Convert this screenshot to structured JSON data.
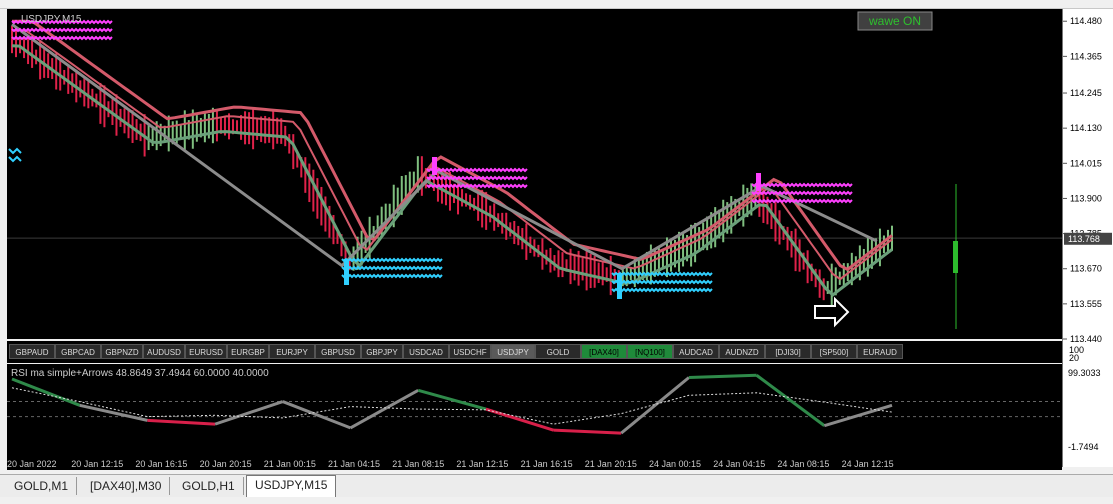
{
  "chart_title": "USDJPY,M15",
  "wawe_button": "wawe ON",
  "price_axis": [
    "114.480",
    "114.365",
    "114.245",
    "114.130",
    "114.015",
    "113.900",
    "113.785",
    "113.670",
    "113.555",
    "113.440"
  ],
  "current_price": "113.768",
  "symbol_buttons": [
    "GBPAUD",
    "GBPCAD",
    "GBPNZD",
    "AUDUSD",
    "EURUSD",
    "EURGBP",
    "EURJPY",
    "GBPUSD",
    "GBPJPY",
    "USDCAD",
    "USDCHF",
    "USDJPY",
    "GOLD",
    "[DAX40]",
    "[NQ100]",
    "AUDCAD",
    "AUDNZD",
    "[DJI30]",
    "[SP500]",
    "EURAUD"
  ],
  "separator_scale": [
    "100",
    "20"
  ],
  "rsi_label": "RSI ma simple+Arrows 48.8649 37.4944 60.0000 40.0000",
  "rsi_axis": [
    "99.3033",
    "-1.7494"
  ],
  "time_axis": [
    "20 Jan 2022",
    "20 Jan 12:15",
    "20 Jan 16:15",
    "20 Jan 20:15",
    "21 Jan 00:15",
    "21 Jan 04:15",
    "21 Jan 08:15",
    "21 Jan 12:15",
    "21 Jan 16:15",
    "21 Jan 20:15",
    "24 Jan 00:15",
    "24 Jan 04:15",
    "24 Jan 08:15",
    "24 Jan 12:15"
  ],
  "tabs": [
    "GOLD,M1",
    "[DAX40],M30",
    "GOLD,H1",
    "USDJPY,M15"
  ],
  "active_tab": "USDJPY,M15",
  "colors": {
    "bull": "#7fbf7f",
    "bear": "#e0224a",
    "ma": "#d45a6a",
    "ma_green": "#6aa07a",
    "zigzag": "#8c8c8c",
    "magenta_arrow": "#ff40ff",
    "cyan_arrow": "#30d0ff",
    "rsi_red": "#d8204a",
    "rsi_green": "#2f8a4a",
    "rsi_gray": "#8a8a8a",
    "button_green": "#1f8a3a"
  },
  "chart_data": {
    "type": "line",
    "title": "USDJPY,M15",
    "ylim": [
      113.44,
      114.52
    ],
    "x": [
      "20 Jan 2022",
      "20 Jan 12:15",
      "20 Jan 16:15",
      "20 Jan 20:15",
      "21 Jan 00:15",
      "21 Jan 04:15",
      "21 Jan 08:15",
      "21 Jan 12:15",
      "21 Jan 16:15",
      "21 Jan 20:15",
      "24 Jan 00:15",
      "24 Jan 04:15",
      "24 Jan 08:15",
      "24 Jan 12:15"
    ],
    "series": [
      {
        "values": [
          114.42,
          114.26,
          114.1,
          114.14,
          114.12,
          113.69,
          113.98,
          113.86,
          113.69,
          113.64,
          113.74,
          113.91,
          113.6,
          113.77
        ]
      }
    ],
    "zigzag": [
      114.47,
      113.68,
      113.99,
      113.67,
      113.94,
      113.76
    ],
    "rsi": [
      90,
      55,
      35,
      30,
      60,
      25,
      75,
      50,
      22,
      18,
      92,
      95,
      28,
      55
    ],
    "rsi_levels": [
      60,
      40
    ],
    "rsi_ylim": [
      -1.7494,
      99.3033
    ]
  }
}
